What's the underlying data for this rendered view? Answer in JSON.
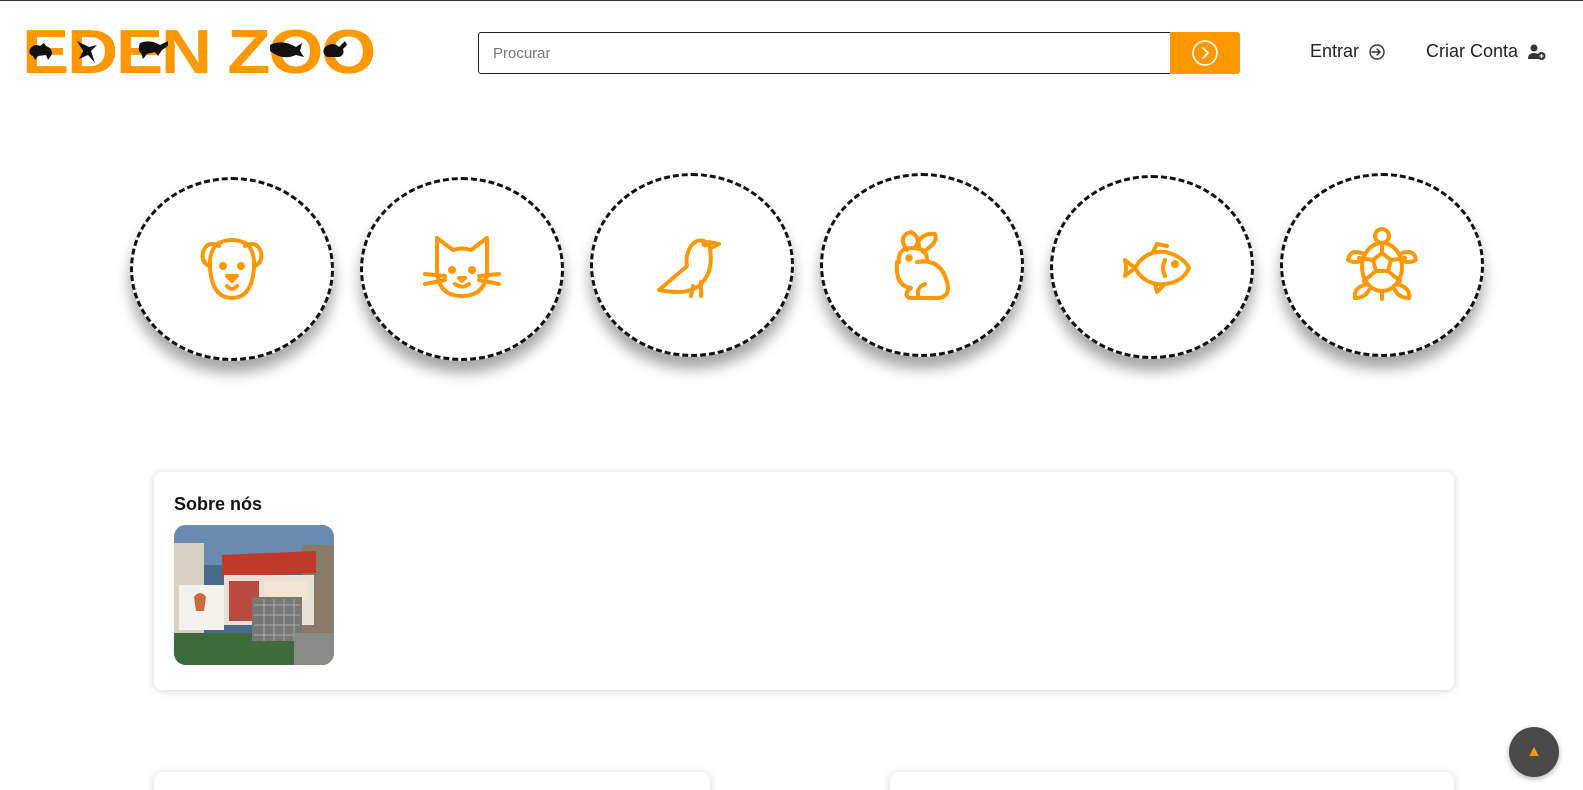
{
  "brand": {
    "name": "EDEN ZOO",
    "color": "#ff9800"
  },
  "search": {
    "placeholder": "Procurar",
    "value": "",
    "button_icon": "arrow-right-circle-icon"
  },
  "nav": {
    "login_label": "Entrar",
    "login_icon": "login-arrow-icon",
    "signup_label": "Criar Conta",
    "signup_icon": "add-user-icon"
  },
  "categories": [
    {
      "icon": "dog-icon"
    },
    {
      "icon": "cat-icon"
    },
    {
      "icon": "bird-icon"
    },
    {
      "icon": "rabbit-icon"
    },
    {
      "icon": "fish-icon"
    },
    {
      "icon": "turtle-icon"
    }
  ],
  "about": {
    "title": "Sobre nós"
  },
  "scroll_top": {
    "icon": "triangle-up-icon",
    "glyph": "▲"
  }
}
